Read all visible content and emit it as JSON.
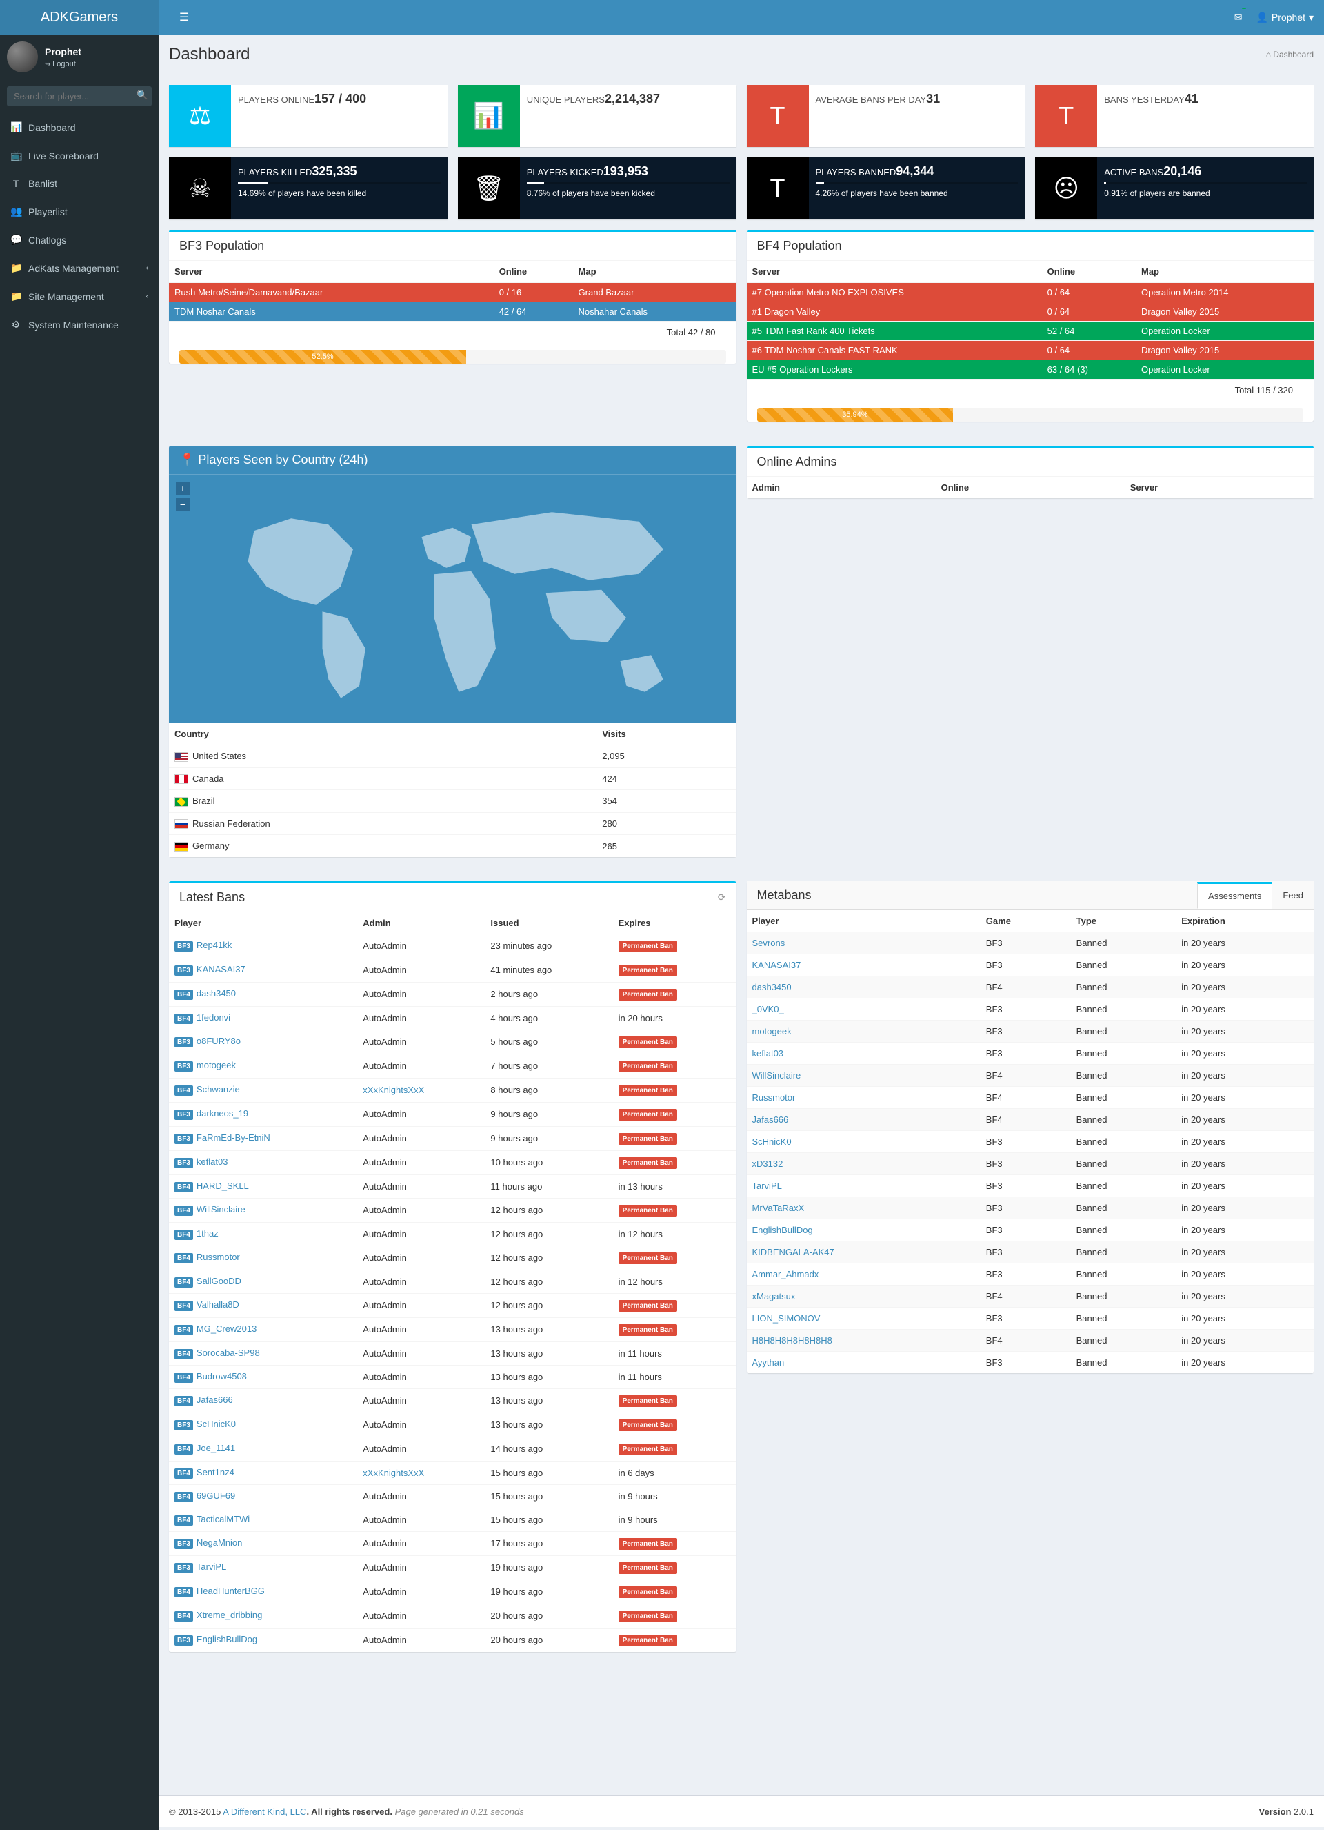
{
  "brand": "ADKGamers",
  "user": {
    "name": "Prophet",
    "logout": "Logout"
  },
  "search_placeholder": "Search for player...",
  "sidebar": [
    {
      "icon": "📊",
      "label": "Dashboard"
    },
    {
      "icon": "📺",
      "label": "Live Scoreboard"
    },
    {
      "icon": "T",
      "label": "Banlist"
    },
    {
      "icon": "👥",
      "label": "Playerlist"
    },
    {
      "icon": "💬",
      "label": "Chatlogs"
    },
    {
      "icon": "📁",
      "label": "AdKats Management",
      "sub": true
    },
    {
      "icon": "📁",
      "label": "Site Management",
      "sub": true
    },
    {
      "icon": "⚙",
      "label": "System Maintenance"
    }
  ],
  "page_title": "Dashboard",
  "breadcrumb": "Dashboard",
  "stats_top": [
    {
      "icon": "⚖",
      "bg": "bg-aqua",
      "label": "PLAYERS ONLINE",
      "value": "157 / 400"
    },
    {
      "icon": "📊",
      "bg": "bg-green",
      "label": "UNIQUE PLAYERS",
      "value": "2,214,387"
    },
    {
      "icon": "T",
      "bg": "bg-red",
      "label": "AVERAGE BANS PER DAY",
      "value": "31"
    },
    {
      "icon": "T",
      "bg": "bg-red",
      "label": "BANS YESTERDAY",
      "value": "41"
    }
  ],
  "stats_dark": [
    {
      "icon": "☠",
      "label": "PLAYERS KILLED",
      "value": "325,335",
      "pct": 14.69,
      "desc": "14.69% of players have been killed"
    },
    {
      "icon": "🗑",
      "label": "PLAYERS KICKED",
      "value": "193,953",
      "pct": 8.76,
      "desc": "8.76% of players have been kicked"
    },
    {
      "icon": "T",
      "label": "PLAYERS BANNED",
      "value": "94,344",
      "pct": 4.26,
      "desc": "4.26% of players have been banned"
    },
    {
      "icon": "☹",
      "label": "ACTIVE BANS",
      "value": "20,146",
      "pct": 0.91,
      "desc": "0.91% of players are banned"
    }
  ],
  "bf3": {
    "title": "BF3 Population",
    "headers": {
      "server": "Server",
      "online": "Online",
      "map": "Map"
    },
    "rows": [
      {
        "cls": "srv-red",
        "server": "Rush Metro/Seine/Damavand/Bazaar",
        "online": "0 / 16",
        "map": "Grand Bazaar"
      },
      {
        "cls": "srv-blue",
        "server": "TDM Noshar Canals",
        "online": "42 / 64",
        "map": "Noshahar Canals"
      }
    ],
    "total": "Total   42 / 80",
    "pct": "52.5%",
    "pctv": 52.5
  },
  "bf4": {
    "title": "BF4 Population",
    "headers": {
      "server": "Server",
      "online": "Online",
      "map": "Map"
    },
    "rows": [
      {
        "cls": "srv-red",
        "server": "#7 Operation Metro NO EXPLOSIVES",
        "online": "0 / 64",
        "map": "Operation Metro 2014"
      },
      {
        "cls": "srv-red",
        "server": "#1 Dragon Valley",
        "online": "0 / 64",
        "map": "Dragon Valley 2015"
      },
      {
        "cls": "srv-green",
        "server": "#5 TDM Fast Rank 400 Tickets",
        "online": "52 / 64",
        "map": "Operation Locker"
      },
      {
        "cls": "srv-red",
        "server": "#6 TDM Noshar Canals FAST RANK",
        "online": "0 / 64",
        "map": "Dragon Valley 2015"
      },
      {
        "cls": "srv-green",
        "server": "EU #5 Operation Lockers",
        "online": "63 / 64 (3)",
        "map": "Operation Locker"
      }
    ],
    "total": "Total   115 / 320",
    "pct": "35.94%",
    "pctv": 35.94
  },
  "map_title": "Players Seen by Country (24h)",
  "countries": {
    "headers": {
      "country": "Country",
      "visits": "Visits"
    },
    "rows": [
      {
        "flag": "flag-us",
        "name": "United States",
        "visits": "2,095"
      },
      {
        "flag": "flag-ca",
        "name": "Canada",
        "visits": "424"
      },
      {
        "flag": "flag-br",
        "name": "Brazil",
        "visits": "354"
      },
      {
        "flag": "flag-ru",
        "name": "Russian Federation",
        "visits": "280"
      },
      {
        "flag": "flag-de",
        "name": "Germany",
        "visits": "265"
      }
    ]
  },
  "admins": {
    "title": "Online Admins",
    "headers": {
      "admin": "Admin",
      "online": "Online",
      "server": "Server"
    }
  },
  "latest_bans": {
    "title": "Latest Bans",
    "headers": {
      "player": "Player",
      "admin": "Admin",
      "issued": "Issued",
      "expires": "Expires"
    },
    "perm": "Permanent Ban",
    "rows": [
      {
        "g": "BF3",
        "player": "Rep41kk",
        "admin": "AutoAdmin",
        "issued": "23 minutes ago",
        "exp": "perm"
      },
      {
        "g": "BF3",
        "player": "KANASAI37",
        "admin": "AutoAdmin",
        "issued": "41 minutes ago",
        "exp": "perm"
      },
      {
        "g": "BF4",
        "player": "dash3450",
        "admin": "AutoAdmin",
        "issued": "2 hours ago",
        "exp": "perm"
      },
      {
        "g": "BF4",
        "player": "1fedonvi",
        "admin": "AutoAdmin",
        "issued": "4 hours ago",
        "exp": "in 20 hours"
      },
      {
        "g": "BF3",
        "player": "o8FURY8o",
        "admin": "AutoAdmin",
        "issued": "5 hours ago",
        "exp": "perm"
      },
      {
        "g": "BF3",
        "player": "motogeek",
        "admin": "AutoAdmin",
        "issued": "7 hours ago",
        "exp": "perm"
      },
      {
        "g": "BF4",
        "player": "Schwanzie",
        "admin": "xXxKnightsXxX",
        "alink": true,
        "issued": "8 hours ago",
        "exp": "perm"
      },
      {
        "g": "BF3",
        "player": "darkneos_19",
        "admin": "AutoAdmin",
        "issued": "9 hours ago",
        "exp": "perm"
      },
      {
        "g": "BF3",
        "player": "FaRmEd-By-EtniN",
        "admin": "AutoAdmin",
        "issued": "9 hours ago",
        "exp": "perm"
      },
      {
        "g": "BF3",
        "player": "keflat03",
        "admin": "AutoAdmin",
        "issued": "10 hours ago",
        "exp": "perm"
      },
      {
        "g": "BF4",
        "player": "HARD_SKLL",
        "admin": "AutoAdmin",
        "issued": "11 hours ago",
        "exp": "in 13 hours"
      },
      {
        "g": "BF4",
        "player": "WillSinclaire",
        "admin": "AutoAdmin",
        "issued": "12 hours ago",
        "exp": "perm"
      },
      {
        "g": "BF4",
        "player": "1thaz",
        "admin": "AutoAdmin",
        "issued": "12 hours ago",
        "exp": "in 12 hours"
      },
      {
        "g": "BF4",
        "player": "Russmotor",
        "admin": "AutoAdmin",
        "issued": "12 hours ago",
        "exp": "perm"
      },
      {
        "g": "BF4",
        "player": "SallGooDD",
        "admin": "AutoAdmin",
        "issued": "12 hours ago",
        "exp": "in 12 hours"
      },
      {
        "g": "BF4",
        "player": "Valhalla8D",
        "admin": "AutoAdmin",
        "issued": "12 hours ago",
        "exp": "perm"
      },
      {
        "g": "BF4",
        "player": "MG_Crew2013",
        "admin": "AutoAdmin",
        "issued": "13 hours ago",
        "exp": "perm"
      },
      {
        "g": "BF4",
        "player": "Sorocaba-SP98",
        "admin": "AutoAdmin",
        "issued": "13 hours ago",
        "exp": "in 11 hours"
      },
      {
        "g": "BF4",
        "player": "Budrow4508",
        "admin": "AutoAdmin",
        "issued": "13 hours ago",
        "exp": "in 11 hours"
      },
      {
        "g": "BF4",
        "player": "Jafas666",
        "admin": "AutoAdmin",
        "issued": "13 hours ago",
        "exp": "perm"
      },
      {
        "g": "BF3",
        "player": "ScHnicK0",
        "admin": "AutoAdmin",
        "issued": "13 hours ago",
        "exp": "perm"
      },
      {
        "g": "BF4",
        "player": "Joe_1141",
        "admin": "AutoAdmin",
        "issued": "14 hours ago",
        "exp": "perm"
      },
      {
        "g": "BF4",
        "player": "Sent1nz4",
        "admin": "xXxKnightsXxX",
        "alink": true,
        "issued": "15 hours ago",
        "exp": "in 6 days"
      },
      {
        "g": "BF4",
        "player": "69GUF69",
        "admin": "AutoAdmin",
        "issued": "15 hours ago",
        "exp": "in 9 hours"
      },
      {
        "g": "BF4",
        "player": "TacticalMTWi",
        "admin": "AutoAdmin",
        "issued": "15 hours ago",
        "exp": "in 9 hours"
      },
      {
        "g": "BF3",
        "player": "NegaMnion",
        "admin": "AutoAdmin",
        "issued": "17 hours ago",
        "exp": "perm"
      },
      {
        "g": "BF3",
        "player": "TarviPL",
        "admin": "AutoAdmin",
        "issued": "19 hours ago",
        "exp": "perm"
      },
      {
        "g": "BF4",
        "player": "HeadHunterBGG",
        "admin": "AutoAdmin",
        "issued": "19 hours ago",
        "exp": "perm"
      },
      {
        "g": "BF4",
        "player": "Xtreme_dribbing",
        "admin": "AutoAdmin",
        "issued": "20 hours ago",
        "exp": "perm"
      },
      {
        "g": "BF3",
        "player": "EnglishBullDog",
        "admin": "AutoAdmin",
        "issued": "20 hours ago",
        "exp": "perm"
      }
    ]
  },
  "metabans": {
    "title": "Metabans",
    "tabs": [
      "Assessments",
      "Feed"
    ],
    "headers": {
      "player": "Player",
      "game": "Game",
      "type": "Type",
      "exp": "Expiration"
    },
    "rows": [
      {
        "player": "Sevrons",
        "game": "BF3",
        "type": "Banned",
        "exp": "in 20 years"
      },
      {
        "player": "KANASAI37",
        "game": "BF3",
        "type": "Banned",
        "exp": "in 20 years"
      },
      {
        "player": "dash3450",
        "game": "BF4",
        "type": "Banned",
        "exp": "in 20 years"
      },
      {
        "player": "_0VK0_",
        "game": "BF3",
        "type": "Banned",
        "exp": "in 20 years"
      },
      {
        "player": "motogeek",
        "game": "BF3",
        "type": "Banned",
        "exp": "in 20 years"
      },
      {
        "player": "keflat03",
        "game": "BF3",
        "type": "Banned",
        "exp": "in 20 years"
      },
      {
        "player": "WillSinclaire",
        "game": "BF4",
        "type": "Banned",
        "exp": "in 20 years"
      },
      {
        "player": "Russmotor",
        "game": "BF4",
        "type": "Banned",
        "exp": "in 20 years"
      },
      {
        "player": "Jafas666",
        "game": "BF4",
        "type": "Banned",
        "exp": "in 20 years"
      },
      {
        "player": "ScHnicK0",
        "game": "BF3",
        "type": "Banned",
        "exp": "in 20 years"
      },
      {
        "player": "xD3132",
        "game": "BF3",
        "type": "Banned",
        "exp": "in 20 years"
      },
      {
        "player": "TarviPL",
        "game": "BF3",
        "type": "Banned",
        "exp": "in 20 years"
      },
      {
        "player": "MrVaTaRaxX",
        "game": "BF3",
        "type": "Banned",
        "exp": "in 20 years"
      },
      {
        "player": "EnglishBullDog",
        "game": "BF3",
        "type": "Banned",
        "exp": "in 20 years"
      },
      {
        "player": "KIDBENGALA-AK47",
        "game": "BF3",
        "type": "Banned",
        "exp": "in 20 years"
      },
      {
        "player": "Ammar_Ahmadx",
        "game": "BF3",
        "type": "Banned",
        "exp": "in 20 years"
      },
      {
        "player": "xMagatsux",
        "game": "BF4",
        "type": "Banned",
        "exp": "in 20 years"
      },
      {
        "player": "LION_SIMONOV",
        "game": "BF3",
        "type": "Banned",
        "exp": "in 20 years"
      },
      {
        "player": "H8H8H8H8H8H8H8",
        "game": "BF4",
        "type": "Banned",
        "exp": "in 20 years"
      },
      {
        "player": "Ayythan",
        "game": "BF3",
        "type": "Banned",
        "exp": "in 20 years"
      }
    ]
  },
  "footer": {
    "copyright": "© 2013-2015 ",
    "company": "A Different Kind, LLC",
    "rights": ". All rights reserved. ",
    "gen": "Page generated in 0.21 seconds",
    "version_label": "Version ",
    "version": "2.0.1"
  }
}
